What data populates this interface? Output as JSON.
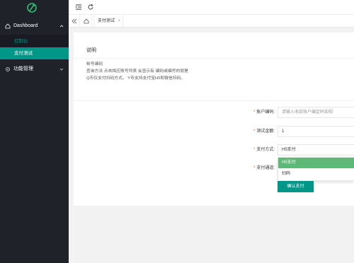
{
  "sidebar": {
    "menu": [
      {
        "label": "Dashboard",
        "expanded": true,
        "icon": "home-icon"
      },
      {
        "label": "功能管理",
        "expanded": false,
        "icon": "gear-icon"
      }
    ],
    "sub_items": [
      {
        "label": "控制台",
        "active": false
      },
      {
        "label": "支付测试",
        "active": true
      }
    ]
  },
  "tabs": [
    {
      "label": "支付测试",
      "close": "×"
    }
  ],
  "notice": {
    "title": "说明",
    "lines": [
      "帐号编码",
      "查询方法 点击相应账号列表 会显示有 编码或编号的就是",
      "Q币仅支付扫码方式。 Y币支持支付宝H5和微信扫码。"
    ]
  },
  "form": {
    "account": {
      "label": "账户编码:",
      "placeholder": "请输入收款账户编定码如视"
    },
    "amount": {
      "label": "测试金额:",
      "value": "1"
    },
    "method": {
      "label": "支付方式:",
      "value": "H5支付"
    },
    "channel": {
      "label": "支付通道:"
    },
    "method_options": [
      {
        "label": "H5支付",
        "selected": true
      },
      {
        "label": "扫码",
        "selected": false
      }
    ],
    "submit_label": "确认支付"
  },
  "colors": {
    "sidebar_bg": "#20222a",
    "accent": "#009688",
    "selected_option": "#5fb878",
    "required": "#ff5722"
  }
}
